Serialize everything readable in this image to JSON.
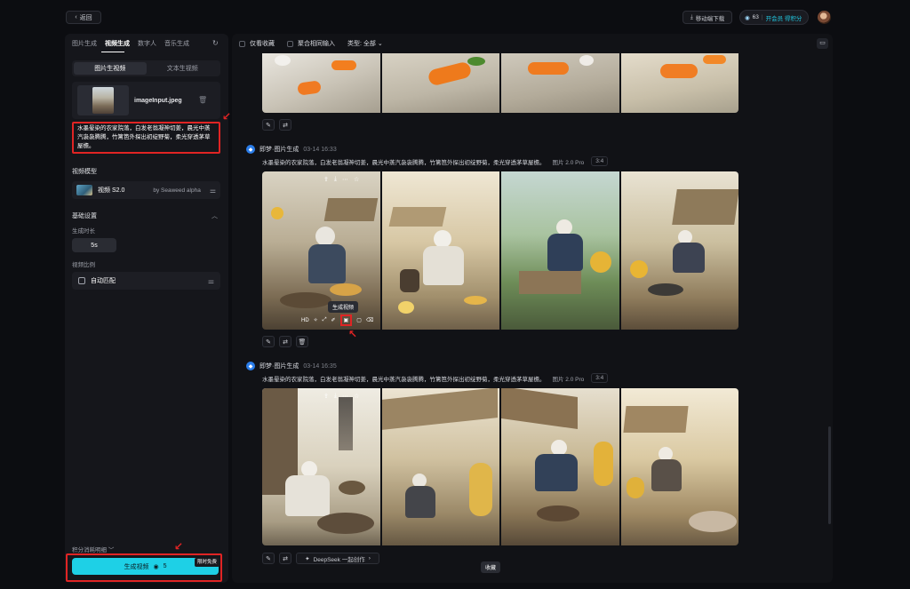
{
  "topbar": {
    "back_label": "返回",
    "download_label": "移动端下载",
    "credits": "63",
    "vip_label": "开会员 得积分"
  },
  "left": {
    "tabs": [
      "图片生成",
      "视频生成",
      "数字人",
      "音乐生成"
    ],
    "active_tab": "视频生成",
    "modes": [
      "图片生视频",
      "文本生视频"
    ],
    "file_name": "imageInput.jpeg",
    "prompt": "水墨晕染的农家院落，白发老翁凝神切姜，晨光中蒸汽袅袅腾腾，竹篱笆外探出初绽野菊，柔光穿透茅草屋檐。",
    "model_section": "视频模型",
    "model_name": "视频 S2.0",
    "model_by": "by Seaweed alpha",
    "basic_settings": "基础设置",
    "duration_label": "生成时长",
    "duration_value": "5s",
    "ratio_label": "视频比例",
    "ratio_value": "自动匹配",
    "credit_detail": "积分消耗明细",
    "generate_label": "生成视频",
    "generate_cost": "5",
    "limited_badge": "限时免费"
  },
  "main": {
    "filters": [
      "仅看收藏",
      "聚合相同输入"
    ],
    "type_filter": "类型: 全部",
    "generations": [
      {
        "source": "即梦·图片生成",
        "time": "03-14  16:33",
        "desc": "水墨晕染的农家院落，白发老翁凝神切姜，晨光中蒸汽袅袅腾腾，竹篱笆外探出初绽野菊，柔光穿透茅草屋檐。",
        "model": "图片 2.0 Pro",
        "ratio": "3:4"
      },
      {
        "source": "即梦·图片生成",
        "time": "03-14  16:35",
        "desc": "水墨晕染的农家院落，白发老翁凝神切姜，晨光中蒸汽袅袅腾腾，竹篱笆外探出初绽野菊，柔光穿透茅草屋檐。",
        "model": "图片 2.0 Pro",
        "ratio": "3:4"
      }
    ],
    "hover_tooltip": "生成视频",
    "hover_hd": "HD",
    "deepseek_label": "DeepSeek 一起创作",
    "collect_tooltip": "收藏"
  },
  "colors": {
    "accent": "#1ed0e6",
    "highlight": "#e02424",
    "background": "#0c0d11"
  }
}
